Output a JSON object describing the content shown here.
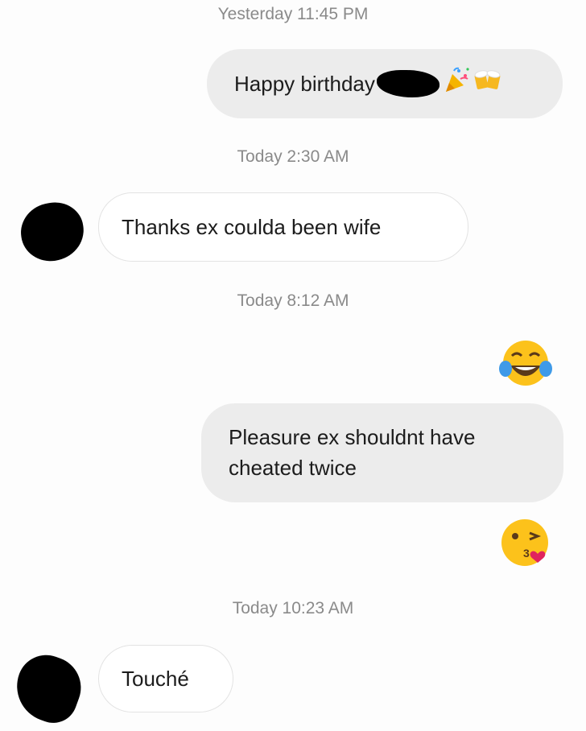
{
  "messages": [
    {
      "timestamp": "Yesterday 11:45 PM",
      "direction": "sent",
      "text": "Happy birthday",
      "trailing_emoji": [
        "party-popper-emoji",
        "beer-mugs-emoji"
      ]
    },
    {
      "timestamp": "Today 2:30 AM",
      "direction": "received",
      "text": "Thanks ex coulda been wife"
    },
    {
      "timestamp": "Today 8:12 AM",
      "direction": "sent",
      "emoji_before": "tears-of-joy-emoji",
      "text": "Pleasure ex shouldnt have cheated twice",
      "lines": [
        "Pleasure ex shouldnt have",
        "cheated twice"
      ],
      "emoji_after": "kissing-heart-emoji"
    },
    {
      "timestamp": "Today 10:23 AM",
      "direction": "received",
      "text": "Touché"
    }
  ],
  "colors": {
    "sent_bubble": "#ececec",
    "received_bubble": "#ffffff",
    "timestamp_text": "#8a8a8a",
    "redaction": "#000000"
  }
}
